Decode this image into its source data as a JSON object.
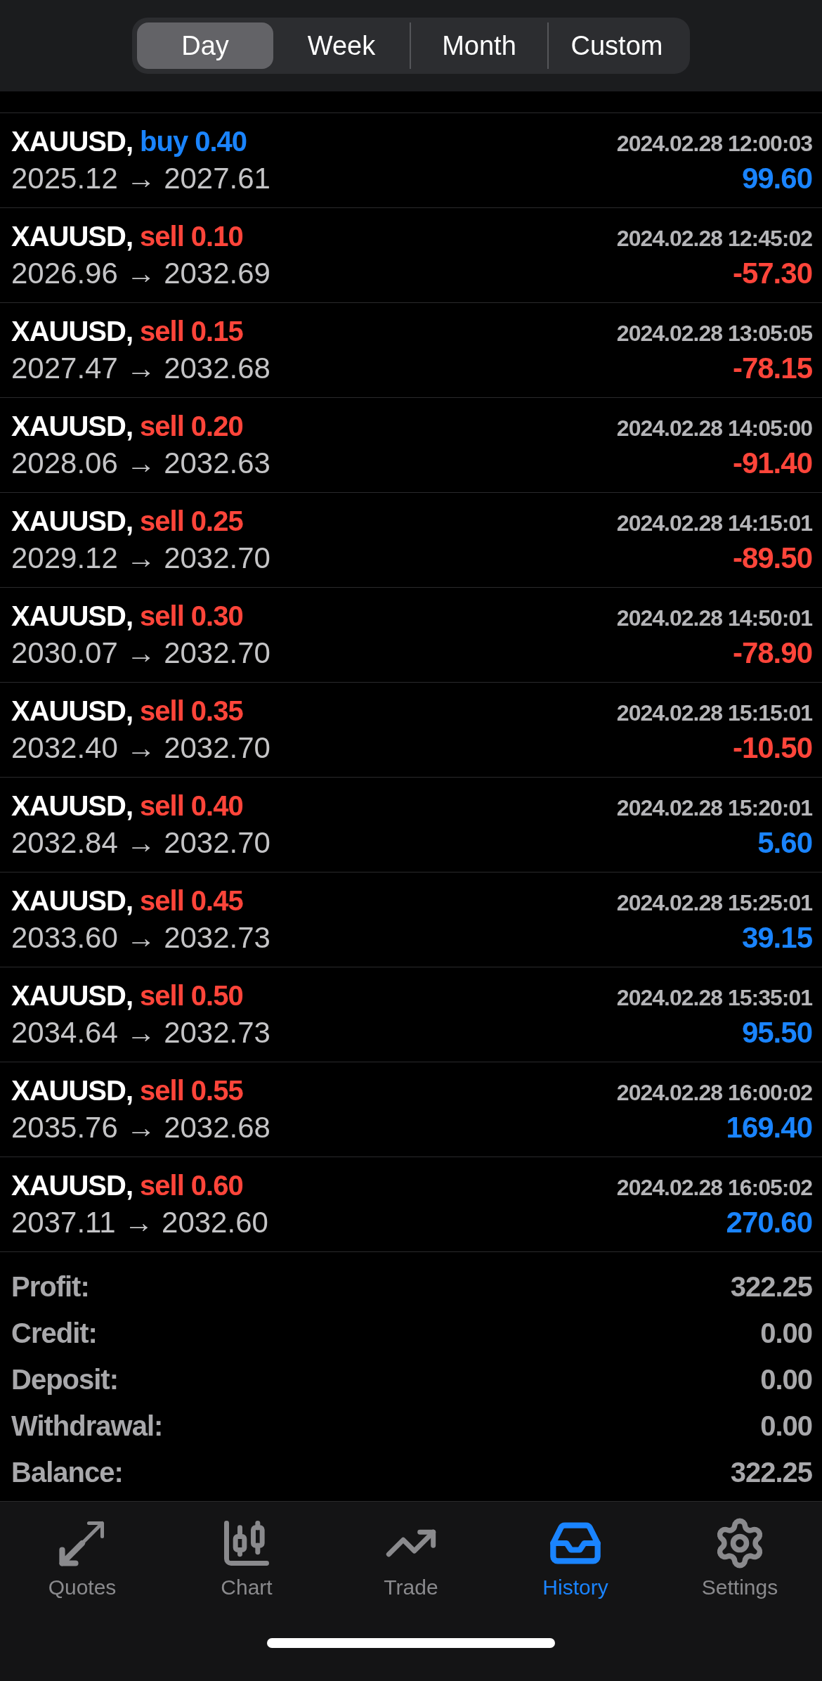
{
  "period_tabs": [
    {
      "label": "Day",
      "selected": true
    },
    {
      "label": "Week",
      "selected": false
    },
    {
      "label": "Month",
      "selected": false
    },
    {
      "label": "Custom",
      "selected": false
    }
  ],
  "deals": [
    {
      "symbol": "XAUUSD,",
      "kind": "buy",
      "lots": "buy 0.40",
      "time": "2024.02.28 12:00:03",
      "prices": "2025.12 → 2027.61",
      "profit": "99.60",
      "loss": false
    },
    {
      "symbol": "XAUUSD,",
      "kind": "sell",
      "lots": "sell 0.10",
      "time": "2024.02.28 12:45:02",
      "prices": "2026.96 → 2032.69",
      "profit": "-57.30",
      "loss": true
    },
    {
      "symbol": "XAUUSD,",
      "kind": "sell",
      "lots": "sell 0.15",
      "time": "2024.02.28 13:05:05",
      "prices": "2027.47 → 2032.68",
      "profit": "-78.15",
      "loss": true
    },
    {
      "symbol": "XAUUSD,",
      "kind": "sell",
      "lots": "sell 0.20",
      "time": "2024.02.28 14:05:00",
      "prices": "2028.06 → 2032.63",
      "profit": "-91.40",
      "loss": true
    },
    {
      "symbol": "XAUUSD,",
      "kind": "sell",
      "lots": "sell 0.25",
      "time": "2024.02.28 14:15:01",
      "prices": "2029.12 → 2032.70",
      "profit": "-89.50",
      "loss": true
    },
    {
      "symbol": "XAUUSD,",
      "kind": "sell",
      "lots": "sell 0.30",
      "time": "2024.02.28 14:50:01",
      "prices": "2030.07 → 2032.70",
      "profit": "-78.90",
      "loss": true
    },
    {
      "symbol": "XAUUSD,",
      "kind": "sell",
      "lots": "sell 0.35",
      "time": "2024.02.28 15:15:01",
      "prices": "2032.40 → 2032.70",
      "profit": "-10.50",
      "loss": true
    },
    {
      "symbol": "XAUUSD,",
      "kind": "sell",
      "lots": "sell 0.40",
      "time": "2024.02.28 15:20:01",
      "prices": "2032.84 → 2032.70",
      "profit": "5.60",
      "loss": false
    },
    {
      "symbol": "XAUUSD,",
      "kind": "sell",
      "lots": "sell 0.45",
      "time": "2024.02.28 15:25:01",
      "prices": "2033.60 → 2032.73",
      "profit": "39.15",
      "loss": false
    },
    {
      "symbol": "XAUUSD,",
      "kind": "sell",
      "lots": "sell 0.50",
      "time": "2024.02.28 15:35:01",
      "prices": "2034.64 → 2032.73",
      "profit": "95.50",
      "loss": false
    },
    {
      "symbol": "XAUUSD,",
      "kind": "sell",
      "lots": "sell 0.55",
      "time": "2024.02.28 16:00:02",
      "prices": "2035.76 → 2032.68",
      "profit": "169.40",
      "loss": false
    },
    {
      "symbol": "XAUUSD,",
      "kind": "sell",
      "lots": "sell 0.60",
      "time": "2024.02.28 16:05:02",
      "prices": "2037.11 → 2032.60",
      "profit": "270.60",
      "loss": false
    }
  ],
  "summary": [
    {
      "label": "Profit:",
      "value": "322.25"
    },
    {
      "label": "Credit:",
      "value": "0.00"
    },
    {
      "label": "Deposit:",
      "value": "0.00"
    },
    {
      "label": "Withdrawal:",
      "value": "0.00"
    },
    {
      "label": "Balance:",
      "value": "322.25"
    }
  ],
  "bottom_tabs": [
    {
      "kind": "quotes",
      "label": "Quotes",
      "selected": false
    },
    {
      "kind": "chart",
      "label": "Chart",
      "selected": false
    },
    {
      "kind": "trade",
      "label": "Trade",
      "selected": false
    },
    {
      "kind": "history",
      "label": "History",
      "selected": true
    },
    {
      "kind": "settings",
      "label": "Settings",
      "selected": false
    }
  ]
}
